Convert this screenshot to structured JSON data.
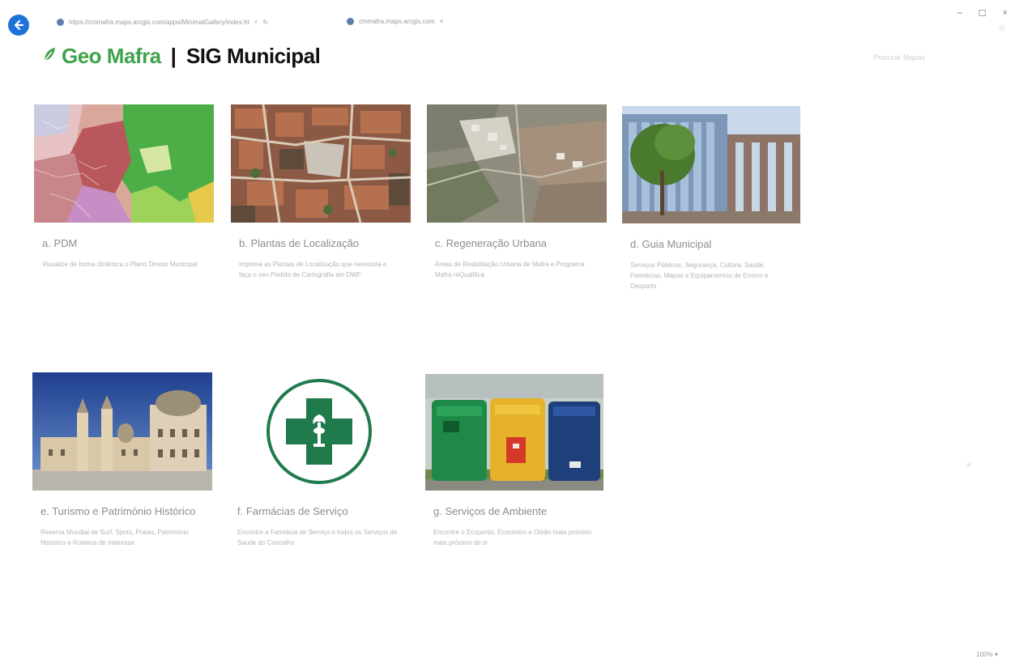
{
  "browser": {
    "url": "https://cmmafra.maps.arcgis.com/apps/MinimalGallery/index.ht",
    "tab_title": "cmmafra.maps.arcgis.com",
    "zoom": "100%"
  },
  "header": {
    "brand_primary": "Geo Mafra",
    "separator": "|",
    "brand_secondary": "SIG Municipal",
    "link": "Procurar Mapas"
  },
  "cards": [
    {
      "title": "a. PDM",
      "desc": "Visualize de forma dinâmica o Plano Diretor Municipal"
    },
    {
      "title": "b. Plantas de Localização",
      "desc": "Imprima as Plantas de Localização que necessita e faça o seu Pedido de Cartografia em DWF"
    },
    {
      "title": "c. Regeneração Urbana",
      "desc": "Áreas de Reabilitação Urbana de Mafra e Programa Mafra reQualifica"
    },
    {
      "title": "d. Guia Municipal",
      "desc": "Serviços Públicos, Segurança, Cultura, Saúde, Farmácias, Mapas e Equipamentos de Ensino e Desporto"
    },
    {
      "title": "e. Turismo e Património Histórico",
      "desc": "Reserva Mundial de Surf, Spots, Praias, Património Histórico e Roteiros de Interesse"
    },
    {
      "title": "f. Farmácias de Serviço",
      "desc": "Encontre a Farmácia de Serviço e todos os Serviços de Saúde do Concelho"
    },
    {
      "title": "g. Serviços de Ambiente",
      "desc": "Encontre o Ecoponto, Ecocentro e Oleão mais próximo mais próximo de si"
    }
  ],
  "colors": {
    "brand_green": "#3fa34d",
    "pharmacy_green": "#1f7a4c",
    "back_button_blue": "#1e73d8"
  },
  "icons": {
    "back": "arrow-left-icon",
    "globe": "globe-icon",
    "leaf": "leaf-icon"
  }
}
